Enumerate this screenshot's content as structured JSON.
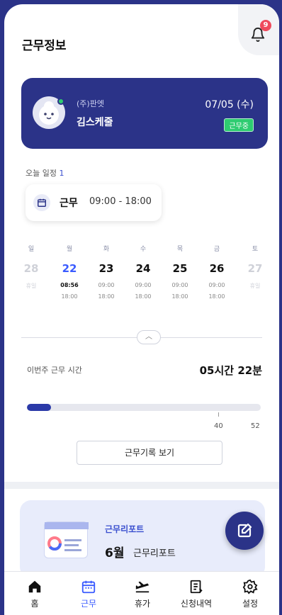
{
  "header": {
    "title": "근무정보",
    "notification_count": "9"
  },
  "profile": {
    "company": "(주)판엣",
    "name": "김스케줄",
    "date": "07/05 (수)",
    "status": "근무중"
  },
  "today": {
    "label": "오늘 일정",
    "count": "1",
    "type": "근무",
    "time": "09:00 - 18:00"
  },
  "week": {
    "days": [
      {
        "dow": "일",
        "date": "28",
        "start": "휴일",
        "end": "",
        "state": "off"
      },
      {
        "dow": "월",
        "date": "22",
        "start": "08:56",
        "end": "18:00",
        "state": "today"
      },
      {
        "dow": "화",
        "date": "23",
        "start": "09:00",
        "end": "18:00",
        "state": "normal"
      },
      {
        "dow": "수",
        "date": "24",
        "start": "09:00",
        "end": "18:00",
        "state": "normal"
      },
      {
        "dow": "목",
        "date": "25",
        "start": "09:00",
        "end": "18:00",
        "state": "normal"
      },
      {
        "dow": "금",
        "date": "26",
        "start": "09:00",
        "end": "18:00",
        "state": "normal"
      },
      {
        "dow": "토",
        "date": "27",
        "start": "휴일",
        "end": "",
        "state": "off"
      }
    ]
  },
  "work_hours": {
    "label": "이번주 근무 시간",
    "value": "05시간 22분",
    "progress_hours": 5.37,
    "max_hours": 52,
    "tick_40": "40",
    "tick_52": "52"
  },
  "record_button": "근무기록 보기",
  "report": {
    "title": "근무리포트",
    "month": "6월",
    "subtitle": "근무리포트"
  },
  "nav": {
    "items": [
      {
        "label": "홈",
        "icon": "home-icon"
      },
      {
        "label": "근무",
        "icon": "calendar-icon",
        "active": true
      },
      {
        "label": "휴가",
        "icon": "plane-icon"
      },
      {
        "label": "신청내역",
        "icon": "document-icon"
      },
      {
        "label": "설정",
        "icon": "gear-icon"
      }
    ]
  },
  "colors": {
    "brand": "#2b3388",
    "accent": "#3a5bff",
    "status_green": "#2ecc71",
    "badge_red": "#ef4a5c"
  }
}
